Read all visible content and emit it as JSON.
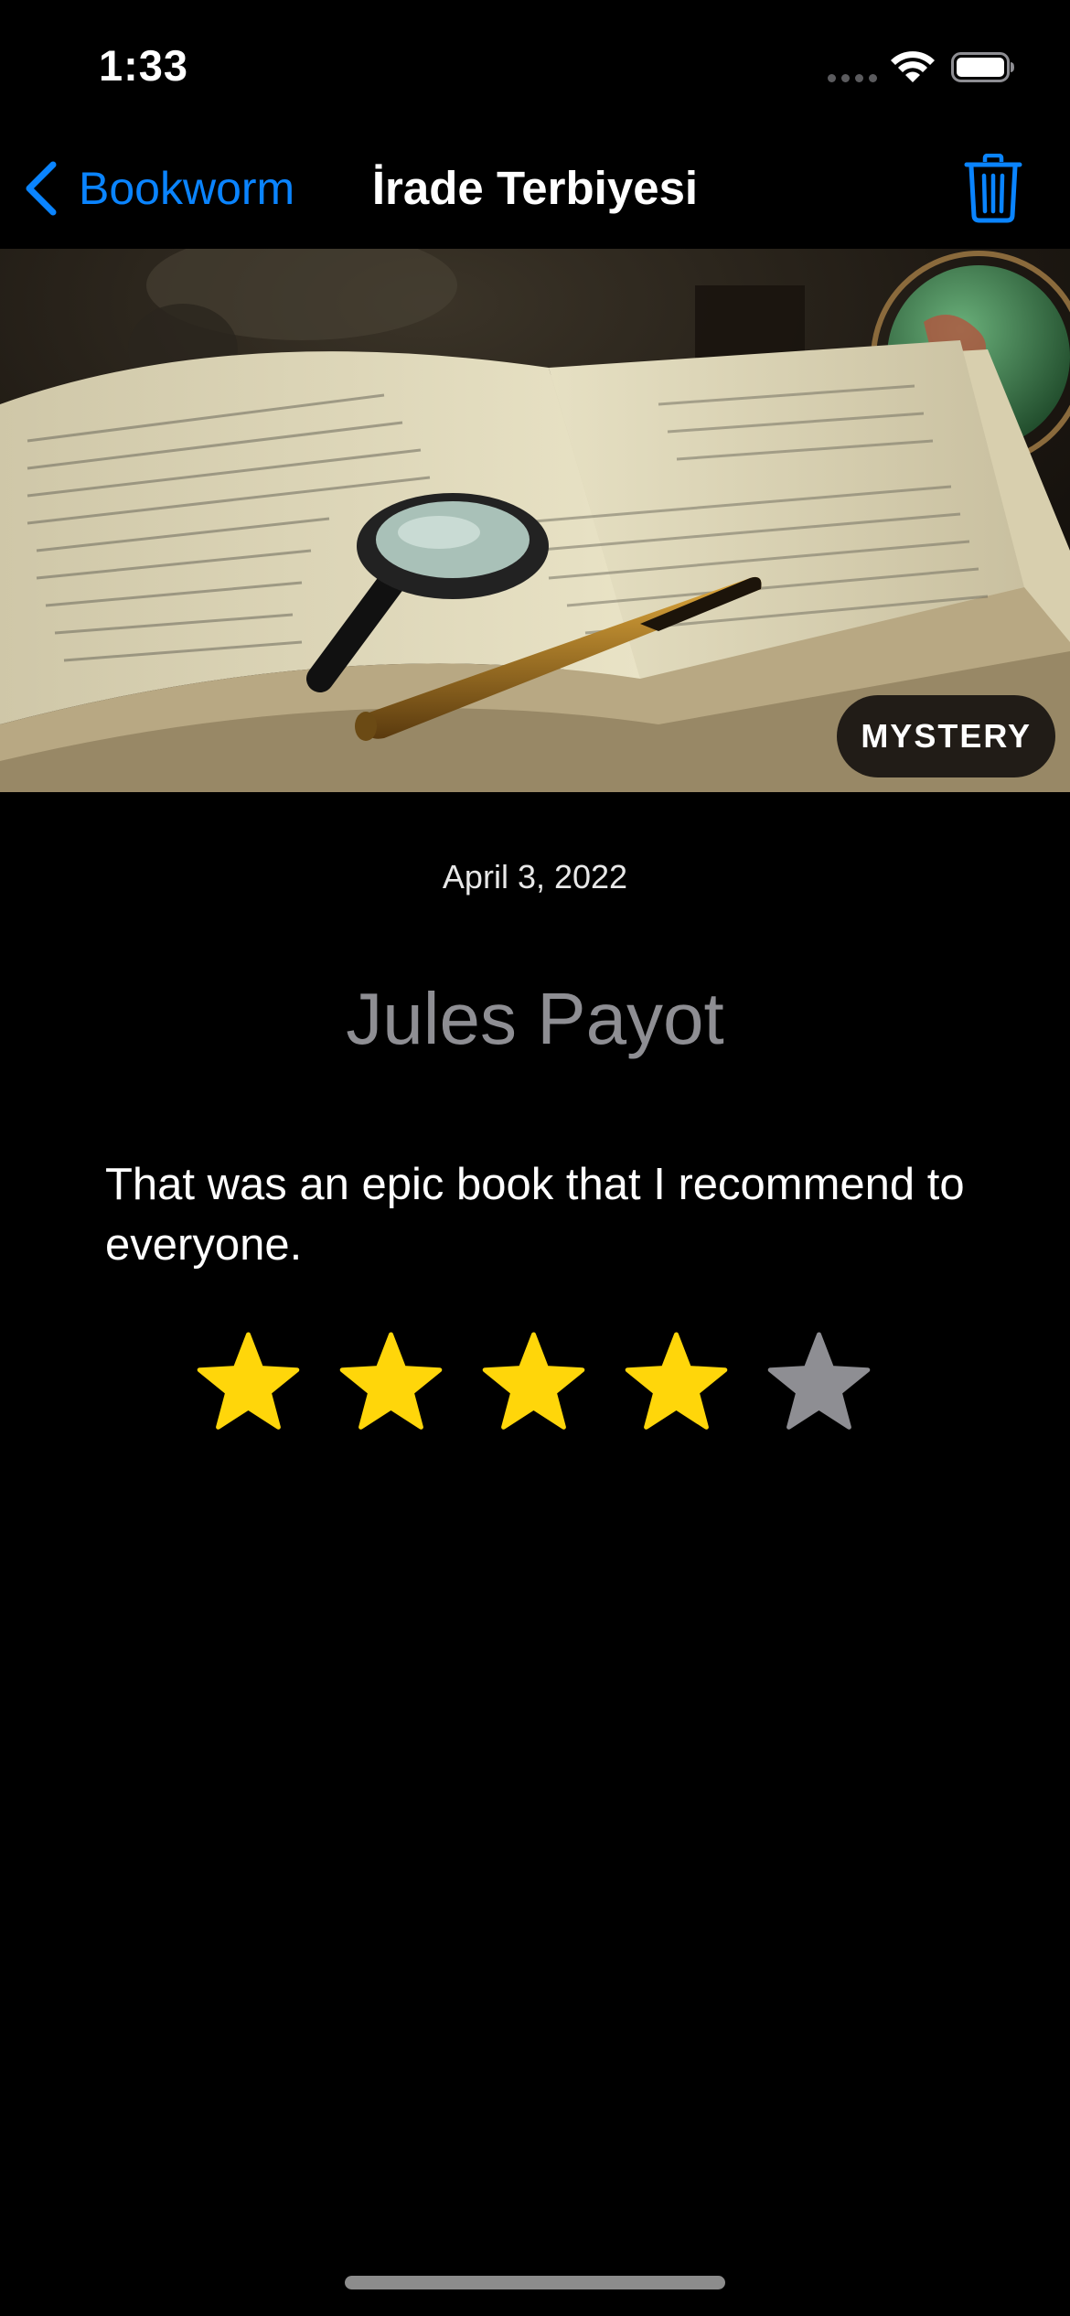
{
  "status_bar": {
    "time": "1:33",
    "icons": [
      "cellular-signal-icon",
      "wifi-icon",
      "battery-icon"
    ]
  },
  "nav": {
    "back_label": "Bookworm",
    "title": "İrade Terbiyesi",
    "back_icon": "chevron-left-icon",
    "delete_icon": "trash-icon",
    "accent_color": "#0a84ff"
  },
  "book": {
    "genre": "MYSTERY",
    "date": "April 3, 2022",
    "author": "Jules Payot",
    "review": "That was an epic book that I recommend to everyone.",
    "rating": 4,
    "max_rating": 5,
    "star_on_color": "#ffd60a",
    "star_off_color": "#8e8e93"
  }
}
